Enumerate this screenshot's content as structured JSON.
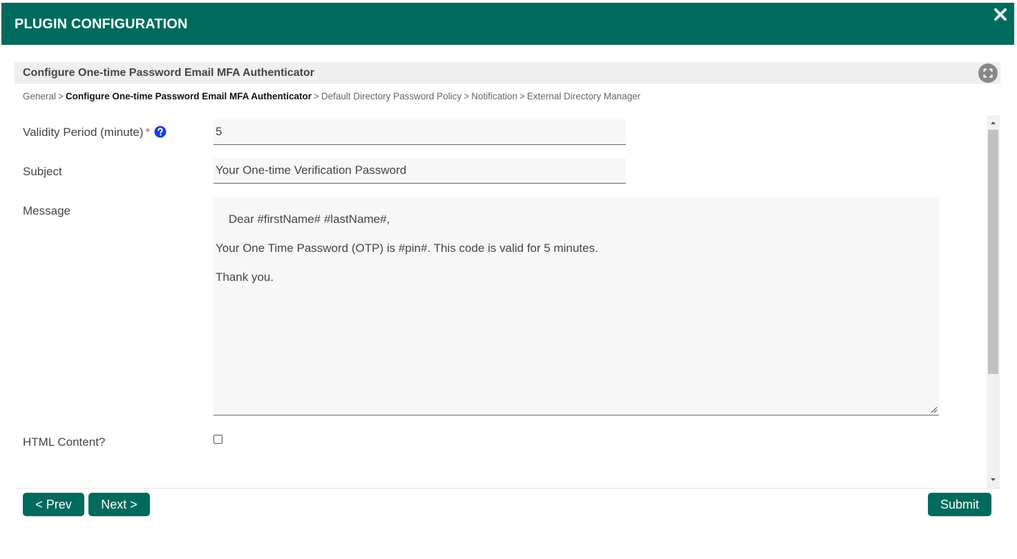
{
  "header": {
    "title": "PLUGIN CONFIGURATION",
    "close_icon": "close-icon"
  },
  "section": {
    "title": "Configure One-time Password Email MFA Authenticator",
    "expand_icon": "fullscreen-icon"
  },
  "breadcrumb": {
    "separator": ">",
    "items": [
      "General",
      "Configure One-time Password Email MFA Authenticator",
      "Default Directory Password Policy",
      "Notification",
      "External Directory Manager"
    ],
    "current_index": 1
  },
  "form": {
    "validity": {
      "label": "Validity Period (minute)",
      "required_mark": "*",
      "value": "5",
      "help_icon": "question-circle-icon"
    },
    "subject": {
      "label": "Subject",
      "value": "Your One-time Verification Password"
    },
    "message": {
      "label": "Message",
      "value": "Dear #firstName# #lastName#,\n\nYour One Time Password (OTP) is #pin#. This code is valid for 5 minutes.\n\nThank you."
    },
    "html_content": {
      "label": "HTML Content?",
      "checked": false
    }
  },
  "buttons": {
    "prev": "< Prev",
    "next": "Next >",
    "submit": "Submit"
  },
  "colors": {
    "brand": "#006b5c",
    "help_icon": "#1a3fd6",
    "required": "#d9534f"
  }
}
